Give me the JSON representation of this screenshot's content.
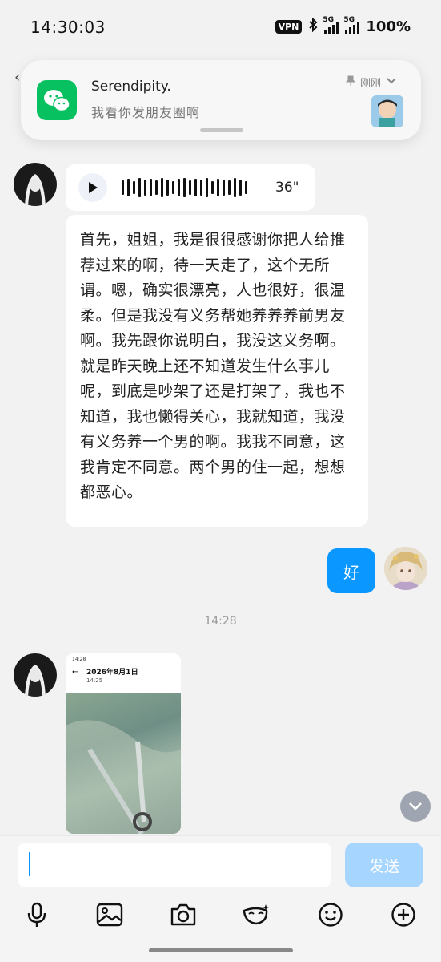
{
  "status_bar": {
    "time": "14:30:03",
    "vpn": "VPN",
    "network_1": "5G",
    "network_2": "5G",
    "battery": "100%"
  },
  "notification": {
    "app_icon": "wechat-icon",
    "title": "Serendipity.",
    "message": "我看你发朋友圈啊",
    "time": "刚刚"
  },
  "messages": {
    "voice": {
      "duration": "36\""
    },
    "text": "首先，姐姐，我是很很感谢你把人给推荐过来的啊，待一天走了，这个无所谓。嗯，确实很漂亮，人也很好，很温柔。但是我没有义务帮她养养养前男友啊。我先跟你说明白，我没这义务啊。就是昨天晚上还不知道发生什么事儿呢，到底是吵架了还是打架了，我也不知道，我也懒得关心，我就知道，我没有义务养一个男的啊。我我不同意，这我肯定不同意。两个男的住一起，想想都恶心。",
    "mine": "好",
    "timestamp": "14:28",
    "image": {
      "status": "14:28",
      "title": "2026年8月1日",
      "subtitle": "14:25"
    }
  },
  "input": {
    "value": "",
    "send_label": "发送"
  },
  "colors": {
    "accent": "#0a97ff",
    "send_disabled": "#a6d6ff",
    "wechat_green": "#07c160"
  }
}
